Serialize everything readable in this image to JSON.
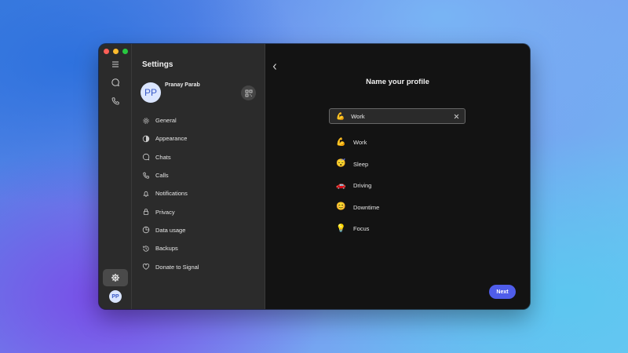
{
  "colors": {
    "accent": "#4f5dea",
    "window_bg": "#1f1f1f",
    "sidebar_bg": "#2b2b2b",
    "main_bg": "#131313"
  },
  "rail": {
    "icons": [
      "menu-icon",
      "chat-icon",
      "phone-icon",
      "gear-icon"
    ],
    "avatar_initials": "PP"
  },
  "settings": {
    "title": "Settings",
    "profile": {
      "initials": "PP",
      "name": "Pranay Parab"
    },
    "items": [
      {
        "label": "General",
        "icon": "gear-icon"
      },
      {
        "label": "Appearance",
        "icon": "appearance-icon"
      },
      {
        "label": "Chats",
        "icon": "chat-icon"
      },
      {
        "label": "Calls",
        "icon": "phone-icon"
      },
      {
        "label": "Notifications",
        "icon": "bell-icon"
      },
      {
        "label": "Privacy",
        "icon": "lock-icon"
      },
      {
        "label": "Data usage",
        "icon": "data-usage-icon"
      },
      {
        "label": "Backups",
        "icon": "backup-icon"
      },
      {
        "label": "Donate to Signal",
        "icon": "heart-icon"
      }
    ]
  },
  "main": {
    "title": "Name your profile",
    "input": {
      "emoji": "💪",
      "value": "Work"
    },
    "suggestions": [
      {
        "emoji": "💪",
        "label": "Work"
      },
      {
        "emoji": "😴",
        "label": "Sleep"
      },
      {
        "emoji": "🚗",
        "label": "Driving"
      },
      {
        "emoji": "😊",
        "label": "Downtime"
      },
      {
        "emoji": "💡",
        "label": "Focus"
      }
    ],
    "next_label": "Next"
  }
}
